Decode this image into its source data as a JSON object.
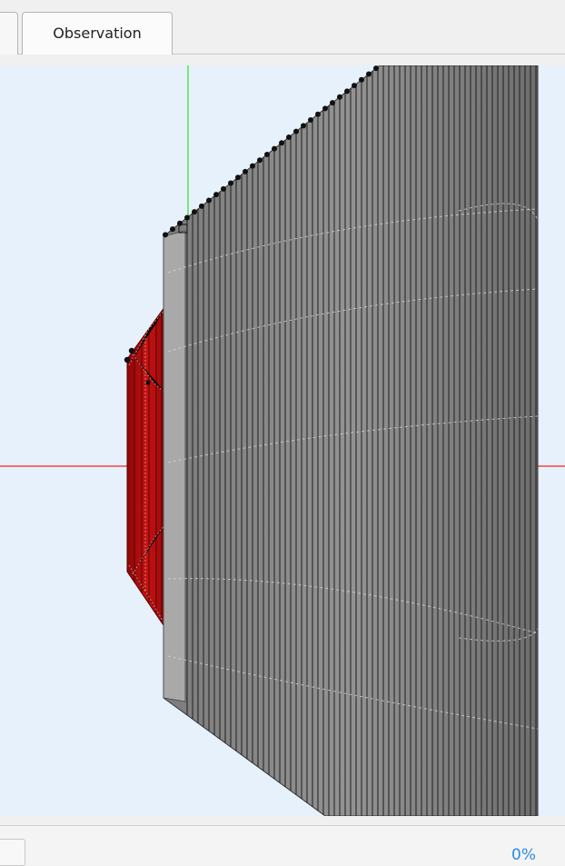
{
  "tabs": [
    {
      "label": ""
    },
    {
      "label": "Observation",
      "active": true
    }
  ],
  "viewport": {
    "background_color": "#e7f1fc",
    "axis_x_color": "#ff2020",
    "axis_y_color": "#5ee35e",
    "body_color": "#8a8a8a",
    "inner_body_color": "#b30d0d"
  },
  "status": {
    "progress_text": "0%",
    "progress_value": 0
  },
  "icons": {
    "status_box": "blank-box-icon"
  }
}
